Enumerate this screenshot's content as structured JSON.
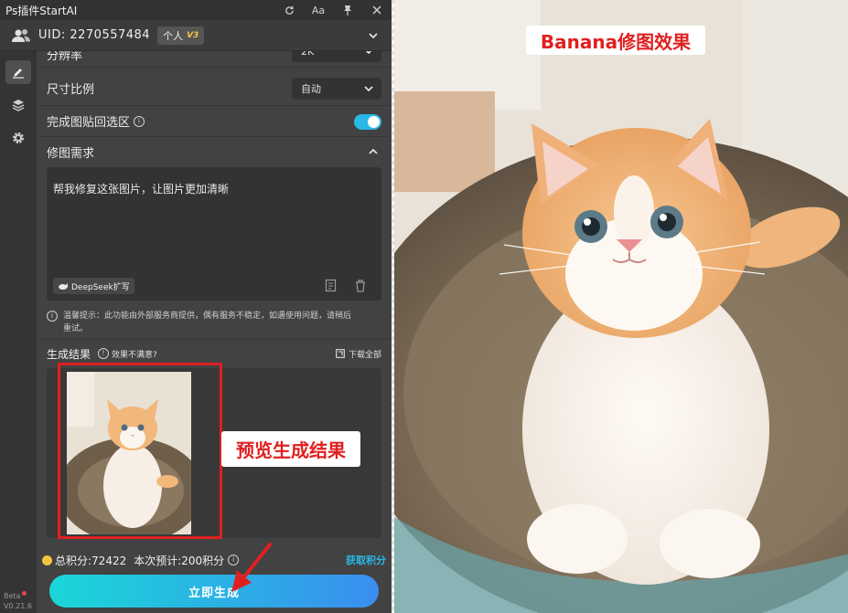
{
  "titlebar": {
    "title": "Ps插件StartAI",
    "font_btn": "Aa"
  },
  "account": {
    "uid": "UID: 2270557484",
    "plan": "个人",
    "plan_version": "V3"
  },
  "settings": {
    "resolution_label": "分辨率",
    "resolution_value": "2K",
    "ratio_label": "尺寸比例",
    "ratio_value": "自动",
    "paste_back_label": "完成图贴回选区",
    "paste_back_on": true
  },
  "prompt": {
    "section_title": "修图需求",
    "text": "帮我修复这张图片，让图片更加清晰",
    "deepseek_btn": "DeepSeek扩写"
  },
  "hint": {
    "line1": "温馨提示：此功能由外部服务商提供，偶有服务不稳定，如遇使用问题，请稍后",
    "line2": "重试。"
  },
  "result": {
    "title": "生成结果",
    "unhappy": "效果不满意?",
    "download_all": "下载全部"
  },
  "annotations": {
    "preview_callout": "预览生成结果",
    "photo_label": "Banana修图效果"
  },
  "footer": {
    "total_points": "总积分:72422",
    "estimate": "本次预计:200积分",
    "get_points": "获取积分",
    "generate_btn": "立即生成"
  },
  "version": {
    "beta": "Beta",
    "number": "V0.21.6"
  },
  "colors": {
    "accent": "#2ab8e6",
    "annotation_red": "#e02020",
    "coin": "#f5c542"
  }
}
